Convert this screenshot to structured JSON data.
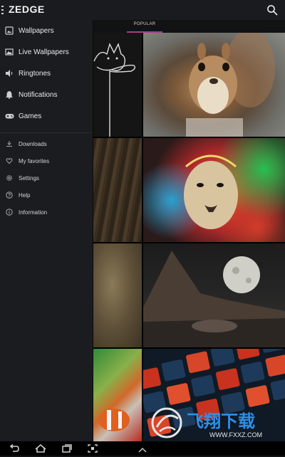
{
  "app": {
    "logo": "ZEDGE"
  },
  "tabs": {
    "popular": "POPULAR"
  },
  "sidebar": {
    "primary": [
      {
        "label": "Wallpapers",
        "icon": "image-icon"
      },
      {
        "label": "Live Wallpapers",
        "icon": "landscape-icon"
      },
      {
        "label": "Ringtones",
        "icon": "speaker-icon"
      },
      {
        "label": "Notifications",
        "icon": "bell-icon"
      },
      {
        "label": "Games",
        "icon": "gamepad-icon"
      }
    ],
    "secondary": [
      {
        "label": "Downloads",
        "icon": "download-icon"
      },
      {
        "label": "My favorites",
        "icon": "heart-icon"
      },
      {
        "label": "Settings",
        "icon": "gear-icon"
      },
      {
        "label": "Help",
        "icon": "help-icon"
      },
      {
        "label": "Information",
        "icon": "info-icon"
      }
    ]
  },
  "watermark": {
    "text": "飞翔下载",
    "url": "WWW.FXXZ.COM"
  },
  "colors": {
    "accent": "#a23d8a",
    "background": "#111214",
    "sidebar": "#1b1c20"
  }
}
